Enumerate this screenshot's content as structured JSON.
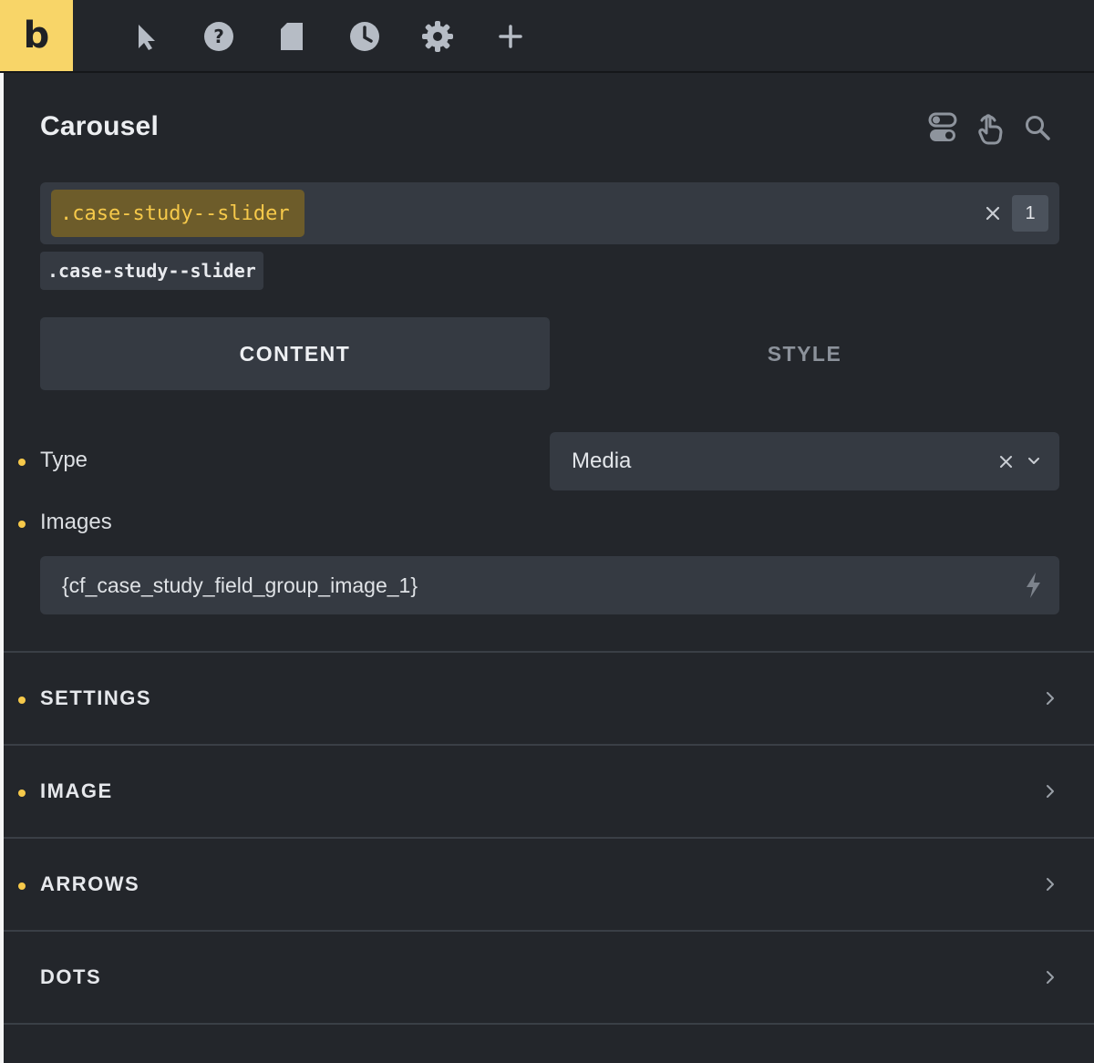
{
  "toolbar": {
    "logo": "b",
    "icons": [
      "cursor-icon",
      "help-icon",
      "page-icon",
      "history-icon",
      "settings-icon",
      "add-icon"
    ]
  },
  "panel": {
    "title": "Carousel",
    "header_icons": [
      "toggle-icon",
      "hand-pointer-icon",
      "search-icon"
    ]
  },
  "selector": {
    "active_class": ".case-study--slider",
    "count": "1",
    "class_tag": ".case-study--slider"
  },
  "tabs": {
    "content": "CONTENT",
    "style": "STYLE",
    "active": "CONTENT"
  },
  "fields": {
    "type_label": "Type",
    "type_value": "Media",
    "images_label": "Images",
    "images_value": "{cf_case_study_field_group_image_1}"
  },
  "sections": [
    {
      "title": "SETTINGS",
      "modified": true
    },
    {
      "title": "IMAGE",
      "modified": true
    },
    {
      "title": "ARROWS",
      "modified": true
    },
    {
      "title": "DOTS",
      "modified": false
    }
  ],
  "colors": {
    "accent": "#f6c94a",
    "logo_bg": "#f8d568",
    "panel_bg": "#23262b",
    "input_bg": "#353a42"
  }
}
